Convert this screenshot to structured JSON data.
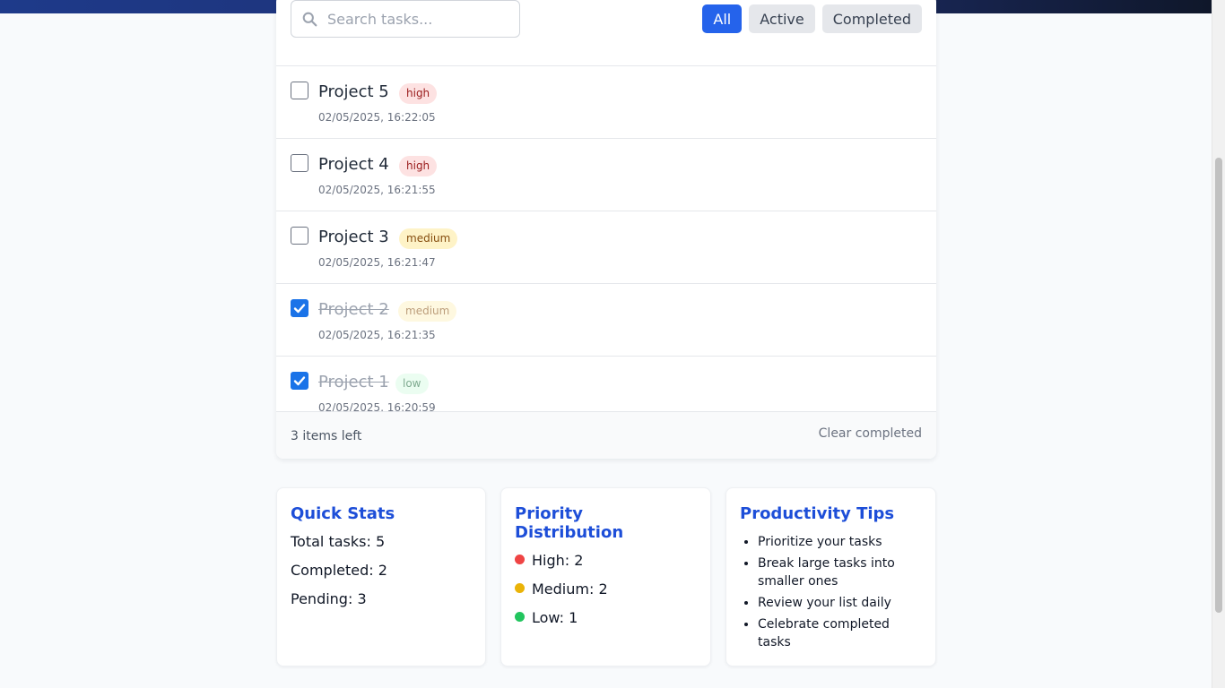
{
  "search": {
    "placeholder": "Search tasks..."
  },
  "filters": [
    {
      "label": "All",
      "active": true
    },
    {
      "label": "Active",
      "active": false
    },
    {
      "label": "Completed",
      "active": false
    }
  ],
  "tasks": [
    {
      "title": "Project 5",
      "priority": "high",
      "timestamp": "02/05/2025, 16:22:05",
      "completed": false
    },
    {
      "title": "Project 4",
      "priority": "high",
      "timestamp": "02/05/2025, 16:21:55",
      "completed": false
    },
    {
      "title": "Project 3",
      "priority": "medium",
      "timestamp": "02/05/2025, 16:21:47",
      "completed": false
    },
    {
      "title": "Project 2",
      "priority": "medium",
      "timestamp": "02/05/2025, 16:21:35",
      "completed": true
    },
    {
      "title": "Project 1",
      "priority": "low",
      "timestamp": "02/05/2025, 16:20:59",
      "completed": true
    }
  ],
  "footer": {
    "items_left": "3 items left",
    "clear_label": "Clear completed"
  },
  "quick_stats": {
    "title": "Quick Stats",
    "total": "Total tasks: 5",
    "completed": "Completed: 2",
    "pending": "Pending: 3"
  },
  "priority_distribution": {
    "title": "Priority Distribution",
    "high": "High: 2",
    "medium": "Medium: 2",
    "low": "Low: 1"
  },
  "tips": {
    "title": "Productivity Tips",
    "items": [
      "Prioritize your tasks",
      "Break large tasks into smaller ones",
      "Review your list daily",
      "Celebrate completed tasks"
    ]
  },
  "colors": {
    "accent": "#2563eb",
    "heading": "#1d4ed8",
    "high": "#ef4444",
    "medium": "#eab308",
    "low": "#22c55e"
  }
}
